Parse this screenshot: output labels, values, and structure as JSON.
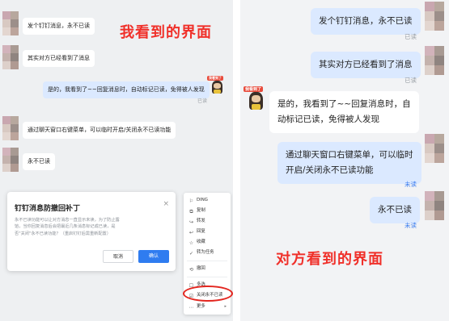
{
  "left": {
    "caption": "我看到的界面",
    "messages": [
      {
        "text": "发个钉钉消息，永不已读"
      },
      {
        "text": "其实对方已经看到了消息"
      },
      {
        "text": "是的，我看到了~~回复消息时，自动标记已读，免得被人发现",
        "status": "已读"
      },
      {
        "text": "通过聊天窗口右键菜单，可以临时开启/关闭永不已读功能"
      },
      {
        "text": "永不已读"
      }
    ],
    "sticker_tag": "我看到了",
    "dialog": {
      "title": "钉钉消息防撤回补丁",
      "close": "×",
      "body": "永不已读功能可以让对方消息一直显示未读，为了防止露\n馅，当你回复消息后会把最近几条消息标记成已读，是\n否\"关闭\"永不已读功能？（重启钉钉后需重新配置）",
      "cancel": "取消",
      "confirm": "确认"
    },
    "menu": [
      {
        "icon": "⚐",
        "label": "DING"
      },
      {
        "icon": "⧉",
        "label": "复制"
      },
      {
        "icon": "↪",
        "label": "转发"
      },
      {
        "icon": "↩",
        "label": "回复"
      },
      {
        "icon": "☆",
        "label": "收藏"
      },
      {
        "icon": "✓",
        "label": "转为任务"
      },
      {
        "icon": "⟲",
        "label": "撤回"
      },
      {
        "icon": "☐",
        "label": "多选"
      },
      {
        "icon": "☑",
        "label": "关闭永不已读"
      },
      {
        "icon": "⋯",
        "label": "更多",
        "arrow": "▸"
      }
    ]
  },
  "right": {
    "caption": "对方看到的界面",
    "messages": [
      {
        "text": "发个钉钉消息，永不已读",
        "status": "已读"
      },
      {
        "text": "其实对方已经看到了消息",
        "status": "已读"
      },
      {
        "text": "是的，我看到了~~回复消息时，自\n动标记已读，免得被人发现"
      },
      {
        "text": "通过聊天窗口右键菜单，可以临时\n开启/关闭永不已读功能",
        "status": "未读"
      },
      {
        "text": "永不已读",
        "status": "未读"
      }
    ],
    "sticker_tag": "我看到了"
  },
  "colors": {
    "accent": "#2f7cf0",
    "highlight_red": "#e3261f",
    "caption_red": "#f0302a",
    "bubble_out": "#dbe9ff",
    "unread_blue": "#3a7cf0"
  },
  "avatar_palette": [
    "#c9a7b0",
    "#b7a89e",
    "#d8c9c2",
    "#9c8f8a",
    "#e3d6d0",
    "#bca59c"
  ]
}
